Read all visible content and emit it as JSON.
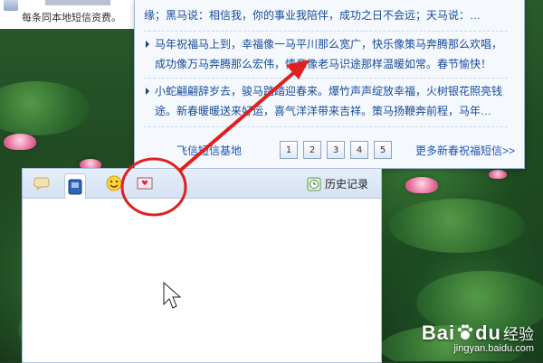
{
  "top_strip": {
    "note": "每条同本地短信资费。"
  },
  "sms_panel": {
    "items": [
      {
        "text": "缘；黑马说：相信我，你的事业我陪伴，成功之日不会远；天马说：…"
      },
      {
        "text": "马年祝福马上到，幸福像一马平川那么宽广，快乐像策马奔腾那么欢唱，成功像万马奔腾那么宏伟，情意像老马识途那样温暖如常。春节愉快！"
      },
      {
        "text": "小蛇翩翩辞岁去，骏马踏踏迎春来。爆竹声声绽放幸福，火树银花照亮钱途。新春暖暖送来好运，喜气洋洋带来吉祥。策马扬鞭奔前程，马年…"
      }
    ],
    "footer": {
      "base_link": "飞信短信基地",
      "pages": [
        "1",
        "2",
        "3",
        "4",
        "5"
      ],
      "more_link": "更多新春祝福短信>>"
    }
  },
  "chat_window": {
    "toolbar": {
      "history_label": "历史记录",
      "buttons": [
        "chat-bubble-icon",
        "blue-card-icon",
        "smiley-icon",
        "greeting-card-icon"
      ]
    }
  },
  "watermark": {
    "brand": "Bai",
    "brand2": "du",
    "jingyan": "经验",
    "url": "jingyan.baidu.com"
  },
  "colors": {
    "link": "#1e55b3",
    "annotation": "#e0201e",
    "panel_bg": "#f5f8fd"
  }
}
